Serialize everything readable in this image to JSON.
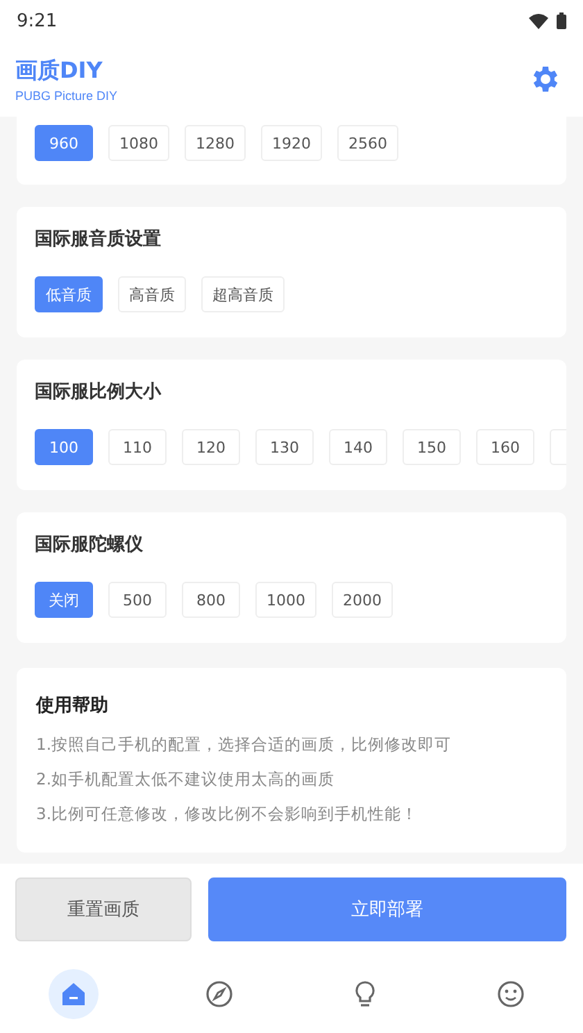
{
  "status_bar": {
    "time": "9:21"
  },
  "header": {
    "title": "画质DIY",
    "subtitle": "PUBG Picture DIY"
  },
  "sections": [
    {
      "options": [
        {
          "label": "960",
          "selected": true
        },
        {
          "label": "1080",
          "selected": false
        },
        {
          "label": "1280",
          "selected": false
        },
        {
          "label": "1920",
          "selected": false
        },
        {
          "label": "2560",
          "selected": false
        }
      ]
    },
    {
      "title": "国际服音质设置",
      "options": [
        {
          "label": "低音质",
          "selected": true
        },
        {
          "label": "高音质",
          "selected": false
        },
        {
          "label": "超高音质",
          "selected": false
        }
      ]
    },
    {
      "title": "国际服比例大小",
      "options": [
        {
          "label": "100",
          "selected": true
        },
        {
          "label": "110",
          "selected": false
        },
        {
          "label": "120",
          "selected": false
        },
        {
          "label": "130",
          "selected": false
        },
        {
          "label": "140",
          "selected": false
        },
        {
          "label": "150",
          "selected": false
        },
        {
          "label": "160",
          "selected": false
        }
      ]
    },
    {
      "title": "国际服陀螺仪",
      "options": [
        {
          "label": "关闭",
          "selected": true
        },
        {
          "label": "500",
          "selected": false
        },
        {
          "label": "800",
          "selected": false
        },
        {
          "label": "1000",
          "selected": false
        },
        {
          "label": "2000",
          "selected": false
        }
      ]
    }
  ],
  "help": {
    "title": "使用帮助",
    "lines": [
      "1.按照自己手机的配置，选择合适的画质，比例修改即可",
      "2.如手机配置太低不建议使用太高的画质",
      "3.比例可任意修改，修改比例不会影响到手机性能！"
    ]
  },
  "actions": [
    {
      "label": "重置画质",
      "kind": "secondary"
    },
    {
      "label": "立即部署",
      "kind": "primary"
    }
  ],
  "nav": [
    {
      "selected": true
    },
    {
      "selected": false
    },
    {
      "selected": false
    },
    {
      "selected": false
    }
  ]
}
